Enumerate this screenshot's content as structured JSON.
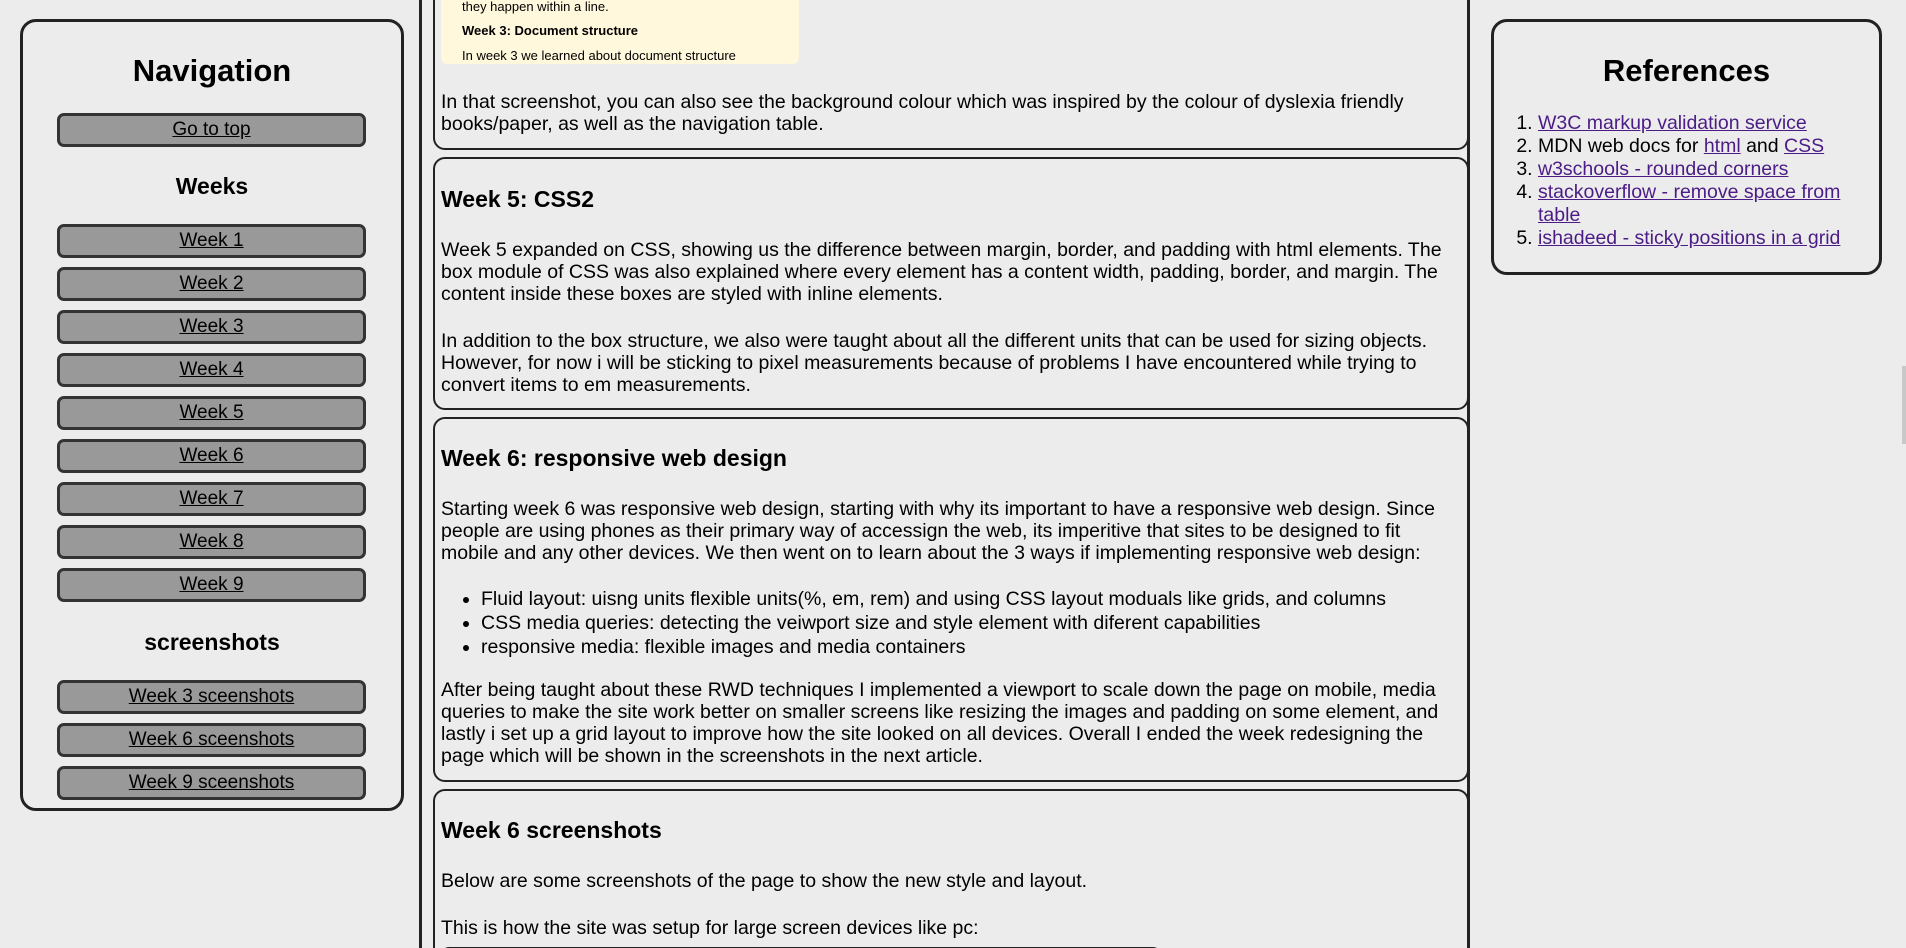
{
  "nav": {
    "title": "Navigation",
    "top_button": "Go to top",
    "weeks_title": "Weeks",
    "weeks": [
      "Week 1",
      "Week 2",
      "Week 3",
      "Week 4",
      "Week 5",
      "Week 6",
      "Week 7",
      "Week 8",
      "Week 9"
    ],
    "screenshots_title": "screenshots",
    "screenshots": [
      "Week 3 sceenshots",
      "Week 6 sceenshots",
      "Week 9 sceenshots"
    ]
  },
  "snippet": {
    "line1": "they happen within a line.",
    "line2": "Week 3: Document structure",
    "line3": "In week 3 we learned about document structure"
  },
  "intro_card": {
    "text": "In that screenshot, you can also see the background colour which was inspired by the colour of dyslexia friendly books/paper, as well as the navigation table."
  },
  "week5": {
    "title": "Week 5: CSS2",
    "p1": "Week 5 expanded on CSS, showing us the difference between margin, border, and padding with html elements. The box module of CSS was also explained where every element has a content width, padding, border, and margin. The content inside these boxes are styled with inline elements.",
    "p2": "In addition to the box structure, we also were taught about all the different units that can be used for sizing objects. However, for now i will be sticking to pixel measurements because of problems I have encountered while trying to convert items to em measurements."
  },
  "week6": {
    "title": "Week 6: responsive web design",
    "p1": "Starting week 6 was responsive web design, starting with why its important to have a responsive web design. Since people are using phones as their primary way of accessign the web, its imperitive that sites to be designed to fit mobile and any other devices. We then went on to learn about the 3 ways if implementing responsive web design:",
    "list": [
      "Fluid layout: uisng units flexible units(%, em, rem) and using CSS layout moduals like grids, and columns",
      "CSS media queries: detecting the veiwport size and style element with diferent capabilities",
      "responsive media: flexible images and media containers"
    ],
    "p2": "After being taught about these RWD techniques I implemented a viewport to scale down the page on mobile, media queries to make the site work better on smaller screens like resizing the images and padding on some element, and lastly i set up a grid layout to improve how the site looked on all devices. Overall I ended the week redesigning the page which will be shown in the screenshots in the next article."
  },
  "week6_screens": {
    "title": "Week 6 screenshots",
    "p1": "Below are some screenshots of the page to show the new style and layout.",
    "p2": "This is how the site was setup for large screen devices like pc:"
  },
  "refs": {
    "title": "References",
    "item1": "W3C markup validation service",
    "item2_prefix": "MDN web docs for ",
    "item2_link1": "html",
    "item2_mid": " and ",
    "item2_link2": "CSS",
    "item3": "w3schools - rounded corners",
    "item4": "stackoverflow - remove space from table",
    "item5": "ishadeed - sticky positions in a grid"
  },
  "colors": {
    "background": "#ececec",
    "button": "#999999",
    "link": "#4b1c86",
    "snippet_bg": "#fff8dc"
  }
}
